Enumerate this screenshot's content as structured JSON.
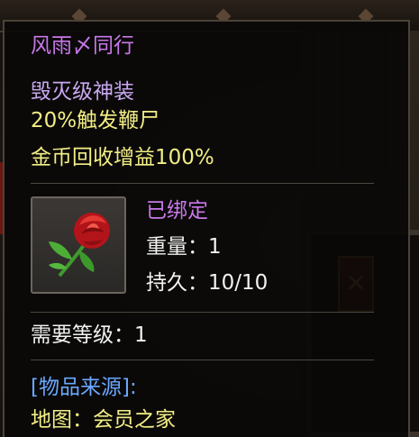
{
  "tooltip": {
    "title": "风雨〆同行",
    "attributes": [
      "毁灭级神装",
      "20%触发鞭尸",
      "金币回收增益100%"
    ],
    "bound_status": "已绑定",
    "weight": "重量：1",
    "durability": "持久：10/10",
    "required_level": "需要等级：1",
    "source_header": "[物品来源]:",
    "source_map": "地图：会员之家"
  },
  "item_icon": "red-rose-icon",
  "colors": {
    "title": "#c878ea",
    "attribute_first": "#c8a8f0",
    "attribute": "#f2ee86",
    "bound": "#c878ea",
    "stat": "#f2f2f2",
    "source_header": "#6aa8ff",
    "source_map": "#f2ee86"
  }
}
